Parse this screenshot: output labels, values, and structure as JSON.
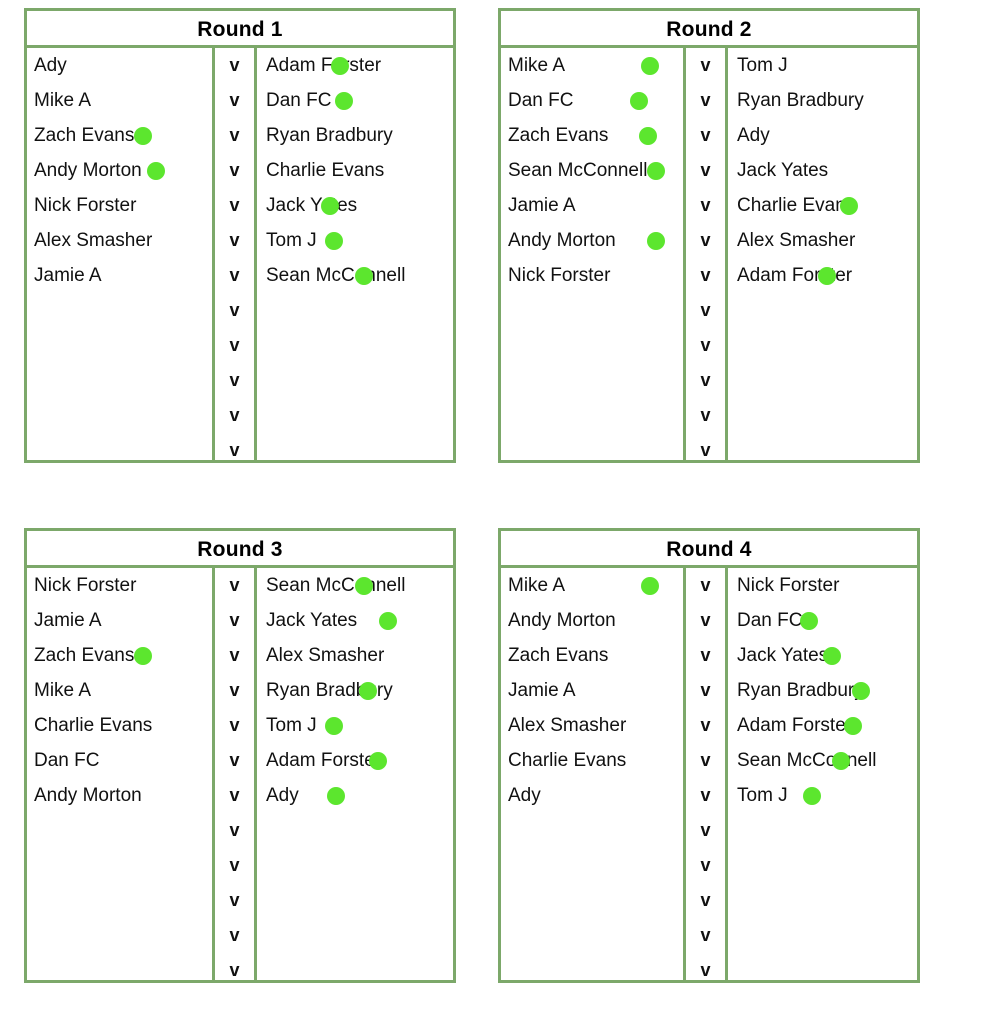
{
  "colors": {
    "border": "#7ca86a",
    "dot": "#5ce62e",
    "text": "#111111",
    "background": "#ffffff"
  },
  "versus_label": "v",
  "rows_per_table": 12,
  "rounds": [
    {
      "id": "round-1",
      "title": "Round 1",
      "matches": [
        {
          "left": "Ady",
          "left_dot": null,
          "right": "Adam Forster",
          "right_dot": 74
        },
        {
          "left": "Mike A",
          "left_dot": null,
          "right": "Dan FC",
          "right_dot": 78
        },
        {
          "left": "Zach Evans",
          "left_dot": 107,
          "right": "Ryan Bradbury",
          "right_dot": null
        },
        {
          "left": "Andy Morton",
          "left_dot": 120,
          "right": "Charlie Evans",
          "right_dot": null
        },
        {
          "left": "Nick Forster",
          "left_dot": null,
          "right": "Jack Yates",
          "right_dot": 64
        },
        {
          "left": "Alex Smasher",
          "left_dot": null,
          "right": "Tom J",
          "right_dot": 68
        },
        {
          "left": "Jamie A",
          "left_dot": null,
          "right": "Sean McConnell",
          "right_dot": 98
        }
      ]
    },
    {
      "id": "round-2",
      "title": "Round 2",
      "matches": [
        {
          "left": "Mike A",
          "left_dot": 140,
          "right": "Tom J",
          "right_dot": null
        },
        {
          "left": "Dan FC",
          "left_dot": 129,
          "right": "Ryan Bradbury",
          "right_dot": null
        },
        {
          "left": "Zach Evans",
          "left_dot": 138,
          "right": "Ady",
          "right_dot": null
        },
        {
          "left": "Sean McConnell",
          "left_dot": 146,
          "right": "Jack Yates",
          "right_dot": null
        },
        {
          "left": "Jamie A",
          "left_dot": null,
          "right": "Charlie Evans",
          "right_dot": 112
        },
        {
          "left": "Andy Morton",
          "left_dot": 146,
          "right": "Alex Smasher",
          "right_dot": null
        },
        {
          "left": "Nick Forster",
          "left_dot": null,
          "right": "Adam Forster",
          "right_dot": 90
        }
      ]
    },
    {
      "id": "round-3",
      "title": "Round 3",
      "matches": [
        {
          "left": "Nick Forster",
          "left_dot": null,
          "right": "Sean McConnell",
          "right_dot": 98
        },
        {
          "left": "Jamie A",
          "left_dot": null,
          "right": "Jack Yates",
          "right_dot": 122
        },
        {
          "left": "Zach Evans",
          "left_dot": 107,
          "right": "Alex Smasher",
          "right_dot": null
        },
        {
          "left": "Mike A",
          "left_dot": null,
          "right": "Ryan Bradbury",
          "right_dot": 102
        },
        {
          "left": "Charlie Evans",
          "left_dot": null,
          "right": "Tom J",
          "right_dot": 68
        },
        {
          "left": "Dan FC",
          "left_dot": null,
          "right": "Adam Forster",
          "right_dot": 112
        },
        {
          "left": "Andy Morton",
          "left_dot": null,
          "right": "Ady",
          "right_dot": 70
        }
      ]
    },
    {
      "id": "round-4",
      "title": "Round 4",
      "matches": [
        {
          "left": "Mike A",
          "left_dot": 140,
          "right": "Nick Forster",
          "right_dot": null
        },
        {
          "left": "Andy Morton",
          "left_dot": null,
          "right": "Dan FC",
          "right_dot": 72
        },
        {
          "left": "Zach Evans",
          "left_dot": null,
          "right": "Jack Yates",
          "right_dot": 95
        },
        {
          "left": "Jamie A",
          "left_dot": null,
          "right": "Ryan Bradbury",
          "right_dot": 124
        },
        {
          "left": "Alex Smasher",
          "left_dot": null,
          "right": "Adam Forster",
          "right_dot": 116
        },
        {
          "left": "Charlie Evans",
          "left_dot": null,
          "right": "Sean McConnell",
          "right_dot": 104
        },
        {
          "left": "Ady",
          "left_dot": null,
          "right": "Tom J",
          "right_dot": 75
        }
      ]
    }
  ]
}
